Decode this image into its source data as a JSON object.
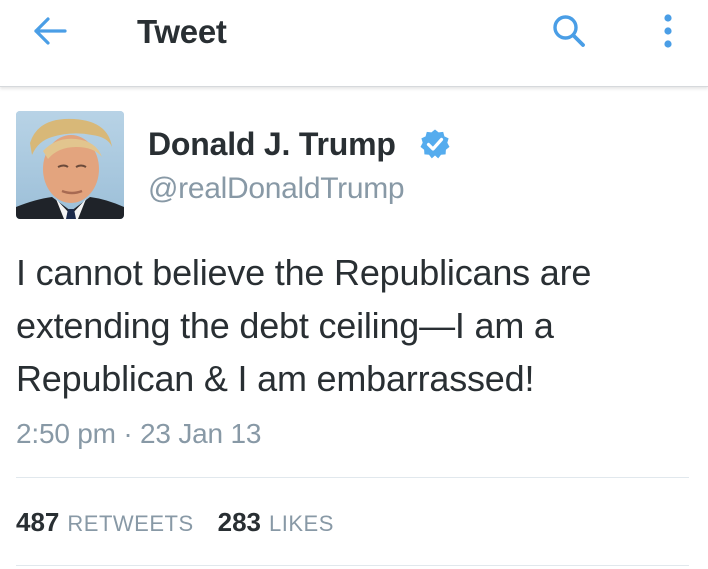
{
  "header": {
    "title": "Tweet"
  },
  "tweet": {
    "author_name": "Donald J. Trump",
    "handle": "@realDonaldTrump",
    "verified": true,
    "text": "I cannot believe the Republicans are extending the debt ceiling—I am a Republican & I am embarrassed!",
    "timestamp": "2:50 pm · 23 Jan 13",
    "retweets_count": "487",
    "retweets_label": "RETWEETS",
    "likes_count": "283",
    "likes_label": "LIKES"
  },
  "icons": {
    "back": "arrow-left-icon",
    "search": "search-icon",
    "more": "more-vertical-icon",
    "verified": "verified-badge-icon"
  },
  "colors": {
    "accent": "#55acee",
    "text": "#292f33",
    "secondary": "#8899a6"
  }
}
